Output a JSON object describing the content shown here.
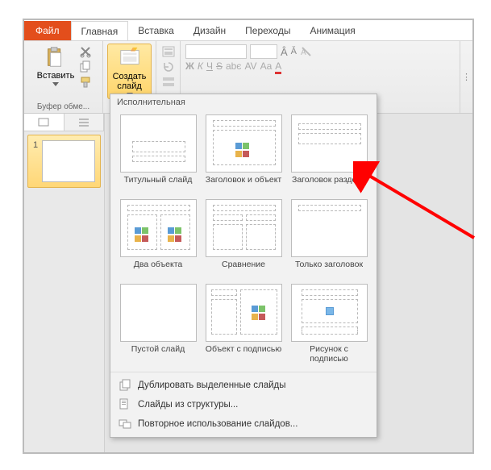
{
  "tabs": {
    "file": "Файл",
    "home": "Главная",
    "insert": "Вставка",
    "design": "Дизайн",
    "transitions": "Переходы",
    "animation": "Анимация"
  },
  "ribbon": {
    "paste_label": "Вставить",
    "new_slide_label": "Создать слайд",
    "clipboard_group": "Буфер обме..."
  },
  "slidebar": {
    "num1": "1"
  },
  "dropdown": {
    "theme_title": "Исполнительная",
    "layouts": [
      {
        "label": "Титульный слайд"
      },
      {
        "label": "Заголовок и объект"
      },
      {
        "label": "Заголовок раздела"
      },
      {
        "label": "Два объекта"
      },
      {
        "label": "Сравнение"
      },
      {
        "label": "Только заголовок"
      },
      {
        "label": "Пустой слайд"
      },
      {
        "label": "Объект с подписью"
      },
      {
        "label": "Рисунок с подписью"
      }
    ],
    "menu": {
      "duplicate": "Дублировать выделенные слайды",
      "outline": "Слайды из структуры...",
      "reuse": "Повторное использование слайдов..."
    }
  }
}
